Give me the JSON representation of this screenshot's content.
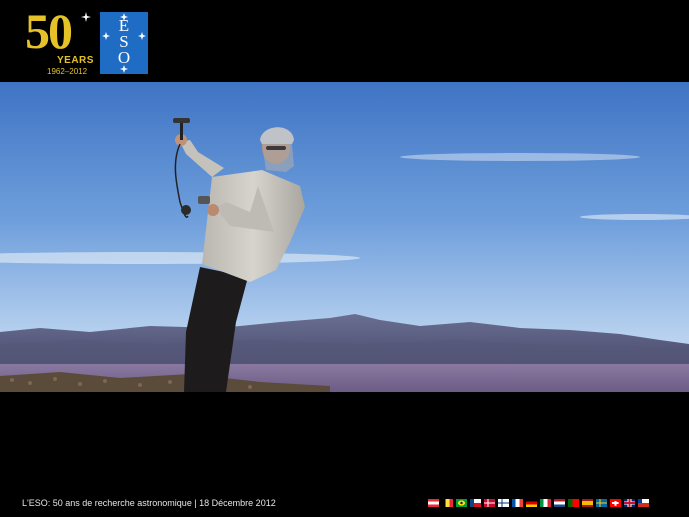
{
  "header": {
    "anniversary_logo": {
      "number": "50",
      "years_label": "YEARS",
      "dates_label": "1962–2012"
    },
    "eso_logo_text": "ESO"
  },
  "photo": {
    "icon": "man-with-anemometer-photo"
  },
  "footer": {
    "caption": "L'ESO: 50 ans de recherche  astronomique | 18 Décembre 2012",
    "flags": [
      {
        "country": "austria",
        "colors": [
          "#ed2939",
          "#ffffff",
          "#ed2939"
        ],
        "dir": "h"
      },
      {
        "country": "belgium",
        "colors": [
          "#000000",
          "#fae042",
          "#ed2939"
        ],
        "dir": "v"
      },
      {
        "country": "brazil",
        "colors": [
          "#009c3b",
          "#ffdf00",
          "#002776"
        ],
        "dir": "brazil"
      },
      {
        "country": "czech-republic",
        "colors": [
          "#ffffff",
          "#d7141a",
          "#11457e"
        ],
        "dir": "cz"
      },
      {
        "country": "denmark",
        "colors": [
          "#c60c30",
          "#ffffff"
        ],
        "dir": "cross"
      },
      {
        "country": "finland",
        "colors": [
          "#ffffff",
          "#003580"
        ],
        "dir": "cross"
      },
      {
        "country": "france",
        "colors": [
          "#0055a4",
          "#ffffff",
          "#ef4135"
        ],
        "dir": "v"
      },
      {
        "country": "germany",
        "colors": [
          "#000000",
          "#dd0000",
          "#ffce00"
        ],
        "dir": "h"
      },
      {
        "country": "italy",
        "colors": [
          "#009246",
          "#ffffff",
          "#ce2b37"
        ],
        "dir": "v"
      },
      {
        "country": "netherlands",
        "colors": [
          "#ae1c28",
          "#ffffff",
          "#21468b"
        ],
        "dir": "h"
      },
      {
        "country": "portugal",
        "colors": [
          "#006600",
          "#ff0000"
        ],
        "dir": "pt"
      },
      {
        "country": "spain",
        "colors": [
          "#aa151b",
          "#f1bf00",
          "#aa151b"
        ],
        "dir": "es"
      },
      {
        "country": "sweden",
        "colors": [
          "#006aa7",
          "#fecc00"
        ],
        "dir": "cross"
      },
      {
        "country": "switzerland",
        "colors": [
          "#ff0000",
          "#ffffff"
        ],
        "dir": "swiss"
      },
      {
        "country": "united-kingdom",
        "colors": [
          "#012169",
          "#ffffff",
          "#c8102e"
        ],
        "dir": "uk"
      },
      {
        "country": "chile",
        "colors": [
          "#ffffff",
          "#d52b1e",
          "#0039a6"
        ],
        "dir": "chile"
      }
    ]
  }
}
